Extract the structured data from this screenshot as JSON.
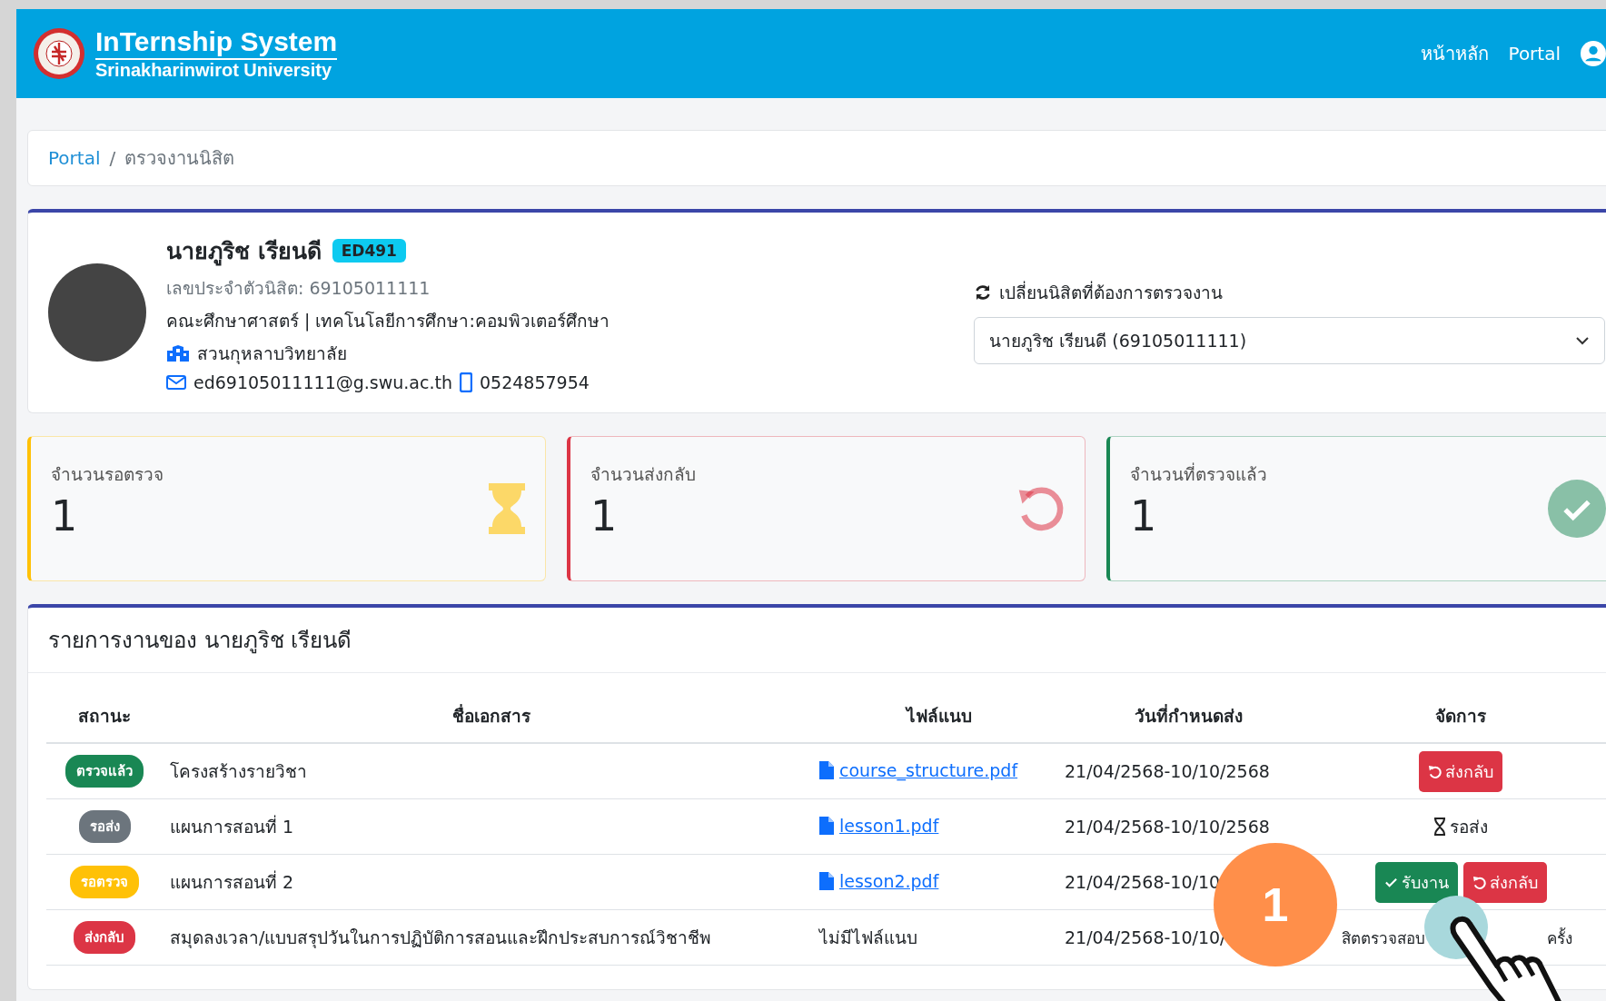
{
  "header": {
    "title": "InTernship System",
    "subtitle": "Srinakharinwirot University",
    "nav": [
      "หน้าหลัก",
      "Portal"
    ]
  },
  "breadcrumb": {
    "items": [
      "Portal",
      "ตรวจงานนิสิต"
    ],
    "separator": "/"
  },
  "student": {
    "name": "นายภูริช เรียนดี",
    "badge": "ED491",
    "id_line": "เลขประจำตัวนิสิต: 69105011111",
    "program": "คณะศึกษาศาสตร์ | เทคโนโลยีการศึกษา:คอมพิวเตอร์ศึกษา",
    "school": "สวนกุหลาบวิทยาลัย",
    "email": "ed69105011111@g.swu.ac.th",
    "phone": "0524857954"
  },
  "switcher": {
    "label": "เปลี่ยนนิสิตที่ต้องการตรวจงาน",
    "value": "นายภูริช เรียนดี (69105011111)"
  },
  "stats": [
    {
      "kind": "pending",
      "label": "จำนวนรอตรวจ",
      "value": "1",
      "color": "#ffc107"
    },
    {
      "kind": "returned",
      "label": "จำนวนส่งกลับ",
      "value": "1",
      "color": "#dc3545"
    },
    {
      "kind": "checked",
      "label": "จำนวนที่ตรวจแล้ว",
      "value": "1",
      "color": "#198754"
    }
  ],
  "tasks": {
    "title": "รายการงานของ นายภูริช เรียนดี",
    "columns": [
      "สถานะ",
      "ชื่อเอกสาร",
      "ไฟล์แนบ",
      "วันที่กำหนดส่ง",
      "จัดการ"
    ],
    "rows": [
      {
        "status": "ตรวจแล้ว",
        "color": "#198754",
        "name": "โครงสร้างรายวิชา",
        "file": {
          "kind": "link",
          "label": "course_structure.pdf"
        },
        "date": "21/04/2568-10/10/2568",
        "actions": [
          {
            "kind": "return",
            "label": "ส่งกลับ"
          }
        ]
      },
      {
        "status": "รอส่ง",
        "color": "#6c757d",
        "name": "แผนการสอนที่ 1",
        "file": {
          "kind": "link",
          "label": "lesson1.pdf"
        },
        "date": "21/04/2568-10/10/2568",
        "actions": [
          {
            "kind": "waiting",
            "label": "รอส่ง"
          }
        ]
      },
      {
        "status": "รอตรวจ",
        "color": "#ffc107",
        "name": "แผนการสอนที่ 2",
        "file": {
          "kind": "link",
          "label": "lesson2.pdf"
        },
        "date": "21/04/2568-10/10",
        "actions": [
          {
            "kind": "accept",
            "label": "รับงาน"
          },
          {
            "kind": "return",
            "label": "ส่งกลับ"
          }
        ]
      },
      {
        "status": "ส่งกลับ",
        "color": "#dc3545",
        "name": "สมุดลงเวลา/แบบสรุปวันในการปฏิบัติการสอนและฝึกประสบการณ์วิชาชีพ",
        "file": {
          "kind": "none",
          "label": "ไม่มีไฟล์แนบ"
        },
        "date": "21/04/2568-10/10/",
        "actions": [
          {
            "kind": "note",
            "label": "สิตตรวจสอบ"
          },
          {
            "kind": "note",
            "label": "ครั้ง"
          }
        ]
      }
    ]
  },
  "callout": {
    "number": "1"
  }
}
